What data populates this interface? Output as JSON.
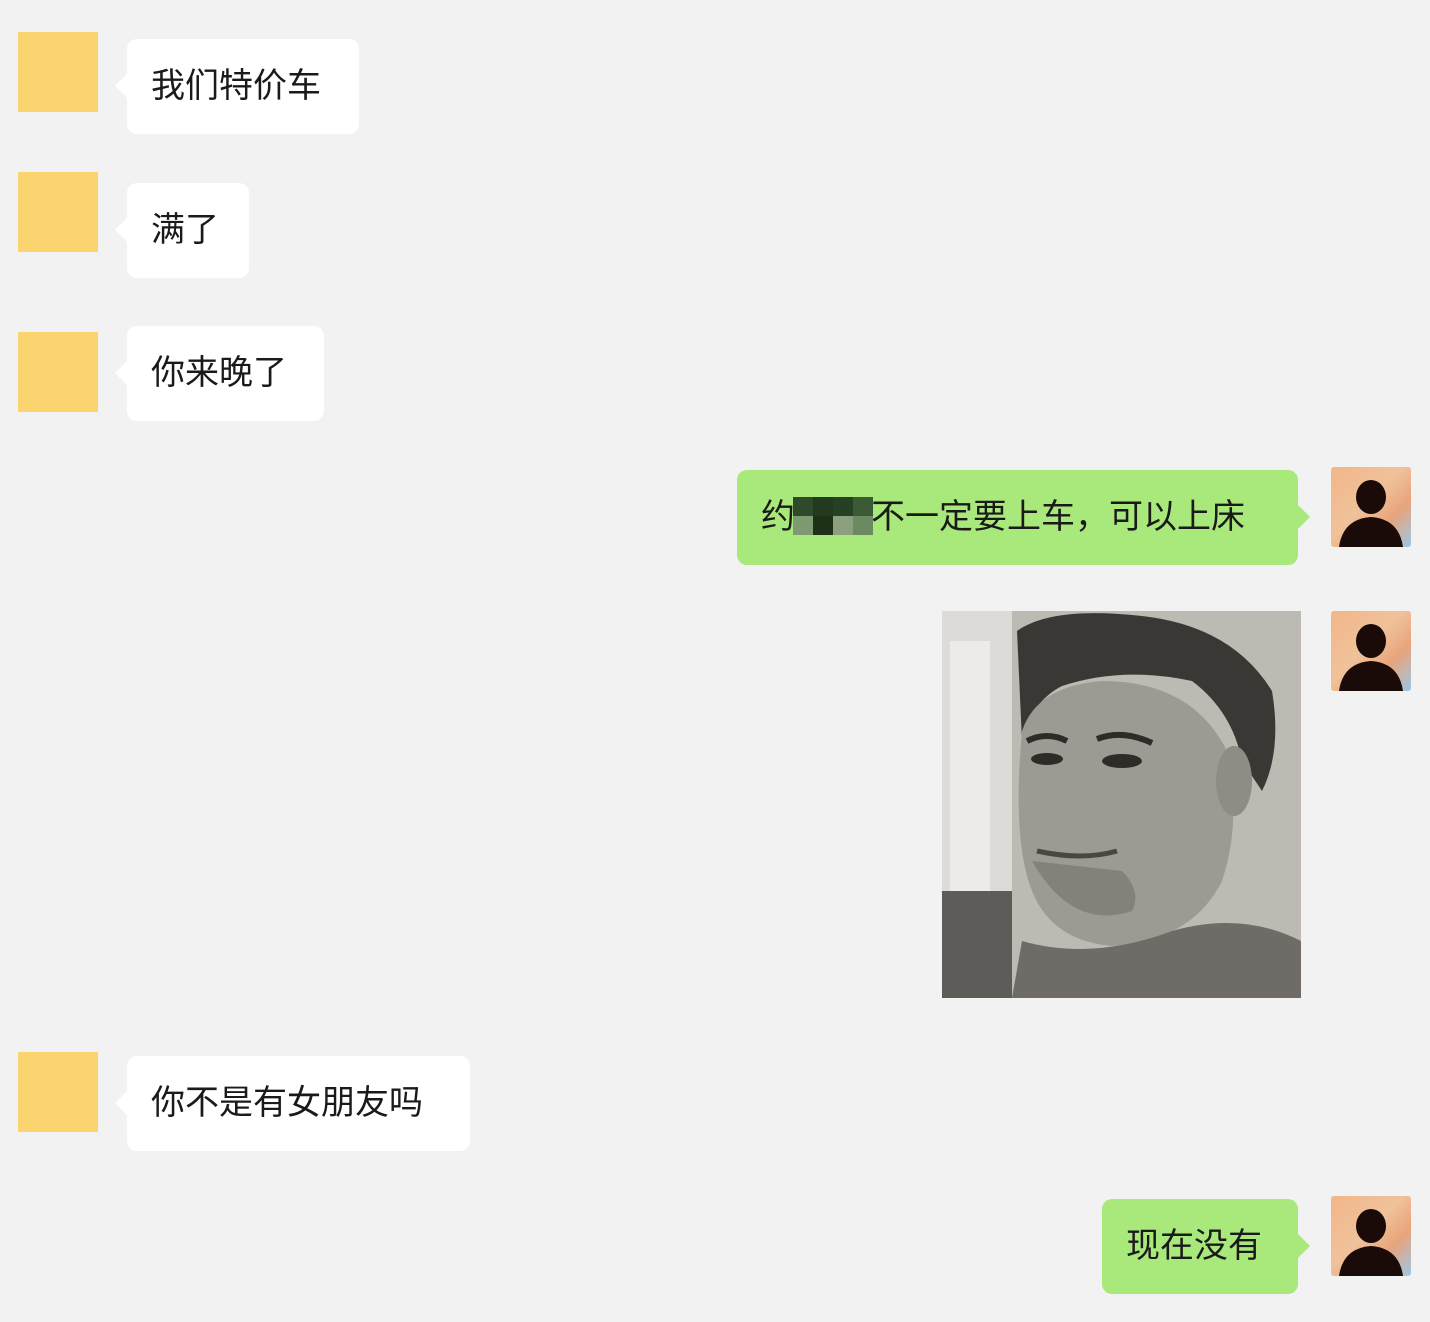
{
  "messages": [
    {
      "side": "left",
      "text": "我们特价车"
    },
    {
      "side": "left",
      "text": "满了"
    },
    {
      "side": "left",
      "text": "你来晚了"
    },
    {
      "side": "right",
      "text_before": "约",
      "text_after": "不一定要上车，可以上床",
      "redacted": true
    },
    {
      "side": "right",
      "type": "image",
      "icon": "portrait-photo"
    },
    {
      "side": "left",
      "text": "你不是有女朋友吗"
    },
    {
      "side": "right",
      "text": "现在没有"
    }
  ],
  "colors": {
    "background": "#f2f2f2",
    "incoming_bubble": "#ffffff",
    "outgoing_bubble": "#a9e97b",
    "contact_avatar": "#fad46e"
  },
  "icons": {
    "contact_avatar": "yellow-square-avatar",
    "self_avatar": "silhouette-avatar"
  }
}
